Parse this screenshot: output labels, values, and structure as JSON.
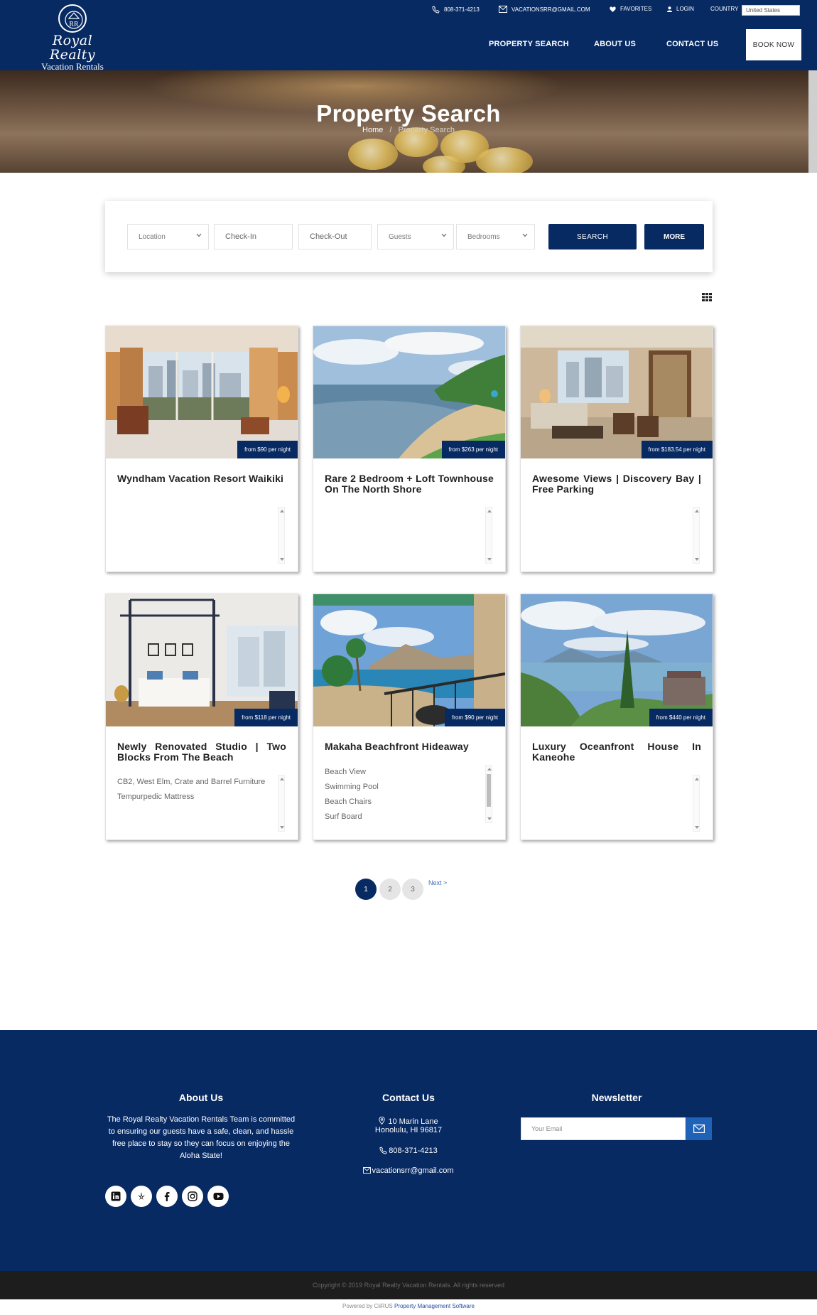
{
  "brand": {
    "logo_script": "Royal Realty",
    "logo_sub": "Vacation Rentals"
  },
  "topbar": {
    "phone": "808-371-4213",
    "email": "VACATIONSRR@GMAIL.COM",
    "favorites": "FAVORITES",
    "login": "LOGIN",
    "country_label": "COUNTRY",
    "country_value": "United States"
  },
  "nav": {
    "property_search": "PROPERTY SEARCH",
    "about_us": "ABOUT US",
    "contact_us": "CONTACT US",
    "book_now": "BOOK NOW"
  },
  "hero": {
    "title": "Property Search",
    "crumb_home": "Home",
    "crumb_sep": "/",
    "crumb_current": "Property Search"
  },
  "search": {
    "location": "Location",
    "check_in": "Check-In",
    "check_out": "Check-Out",
    "guests": "Guests",
    "bedrooms": "Bedrooms",
    "search_button": "SEARCH",
    "more_button": "MORE"
  },
  "listings": [
    {
      "title": "Wyndham Vacation Resort Waikiki",
      "price": "from $90 per night",
      "amenities": []
    },
    {
      "title": "Rare 2 Bedroom + Loft Townhouse On The North Shore",
      "price": "from $263 per night",
      "amenities": []
    },
    {
      "title": "Awesome Views | Discovery Bay | Free Parking",
      "price": "from $183.54 per night",
      "amenities": []
    },
    {
      "title": "Newly Renovated Studio | Two Blocks From The Beach",
      "price": "from $118 per night",
      "amenities": [
        "CB2, West Elm, Crate and Barrel Furniture",
        "Tempurpedic Mattress"
      ]
    },
    {
      "title": "Makaha Beachfront Hideaway",
      "price": "from $90 per night",
      "amenities": [
        "Beach View",
        "Swimming Pool",
        "Beach Chairs",
        "Surf Board"
      ]
    },
    {
      "title": "Luxury Oceanfront House In Kaneohe",
      "price": "from $440 per night",
      "amenities": []
    }
  ],
  "pagination": {
    "pages": [
      "1",
      "2",
      "3"
    ],
    "current": "1",
    "next": "Next >"
  },
  "footer": {
    "about_title": "About Us",
    "about_text": "The Royal Realty Vacation Rentals Team is committed to ensuring our guests have a safe, clean, and hassle free place to stay so they can focus on enjoying the Aloha State!",
    "contact_title": "Contact Us",
    "address_line1": "10 Marin Lane",
    "address_line2": "Honolulu, HI 96817",
    "phone": "808-371-4213",
    "email": "vacationsrr@gmail.com",
    "newsletter_title": "Newsletter",
    "newsletter_placeholder": "Your Email",
    "social": [
      "linkedin-icon",
      "yelp-icon",
      "facebook-icon",
      "instagram-icon",
      "youtube-icon"
    ],
    "copyright": "Copyright © 2019 Royal Realty Vacation Rentals. All rights reserved",
    "powered_prefix": "Powered by CiiRUS",
    "powered_link": "Property Management Software"
  },
  "colors": {
    "navy": "#082a63",
    "accent_blue": "#1f63b9",
    "copy_bar": "#1d1d1d"
  }
}
